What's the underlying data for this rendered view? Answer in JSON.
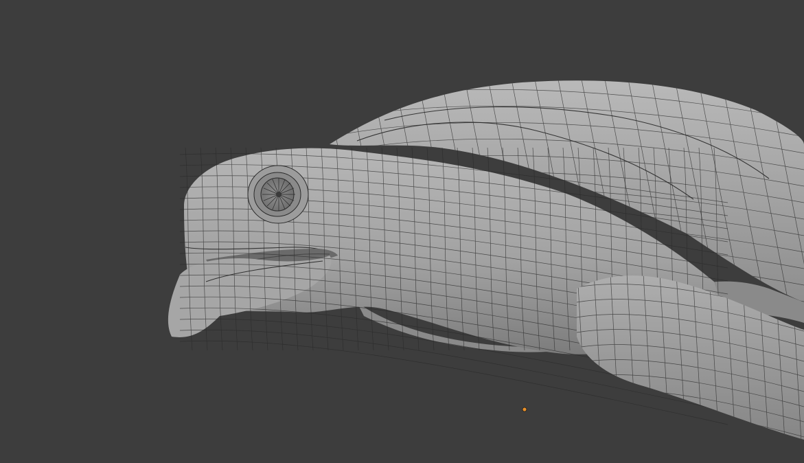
{
  "viewport": {
    "background_color": "#3d3d3d",
    "mesh_color": "#a9a9a9",
    "wire_color": "#2a2a2a",
    "origin_color": "#e8902a",
    "shading": "solid",
    "overlay": "wireframe",
    "object_type": "mesh"
  }
}
